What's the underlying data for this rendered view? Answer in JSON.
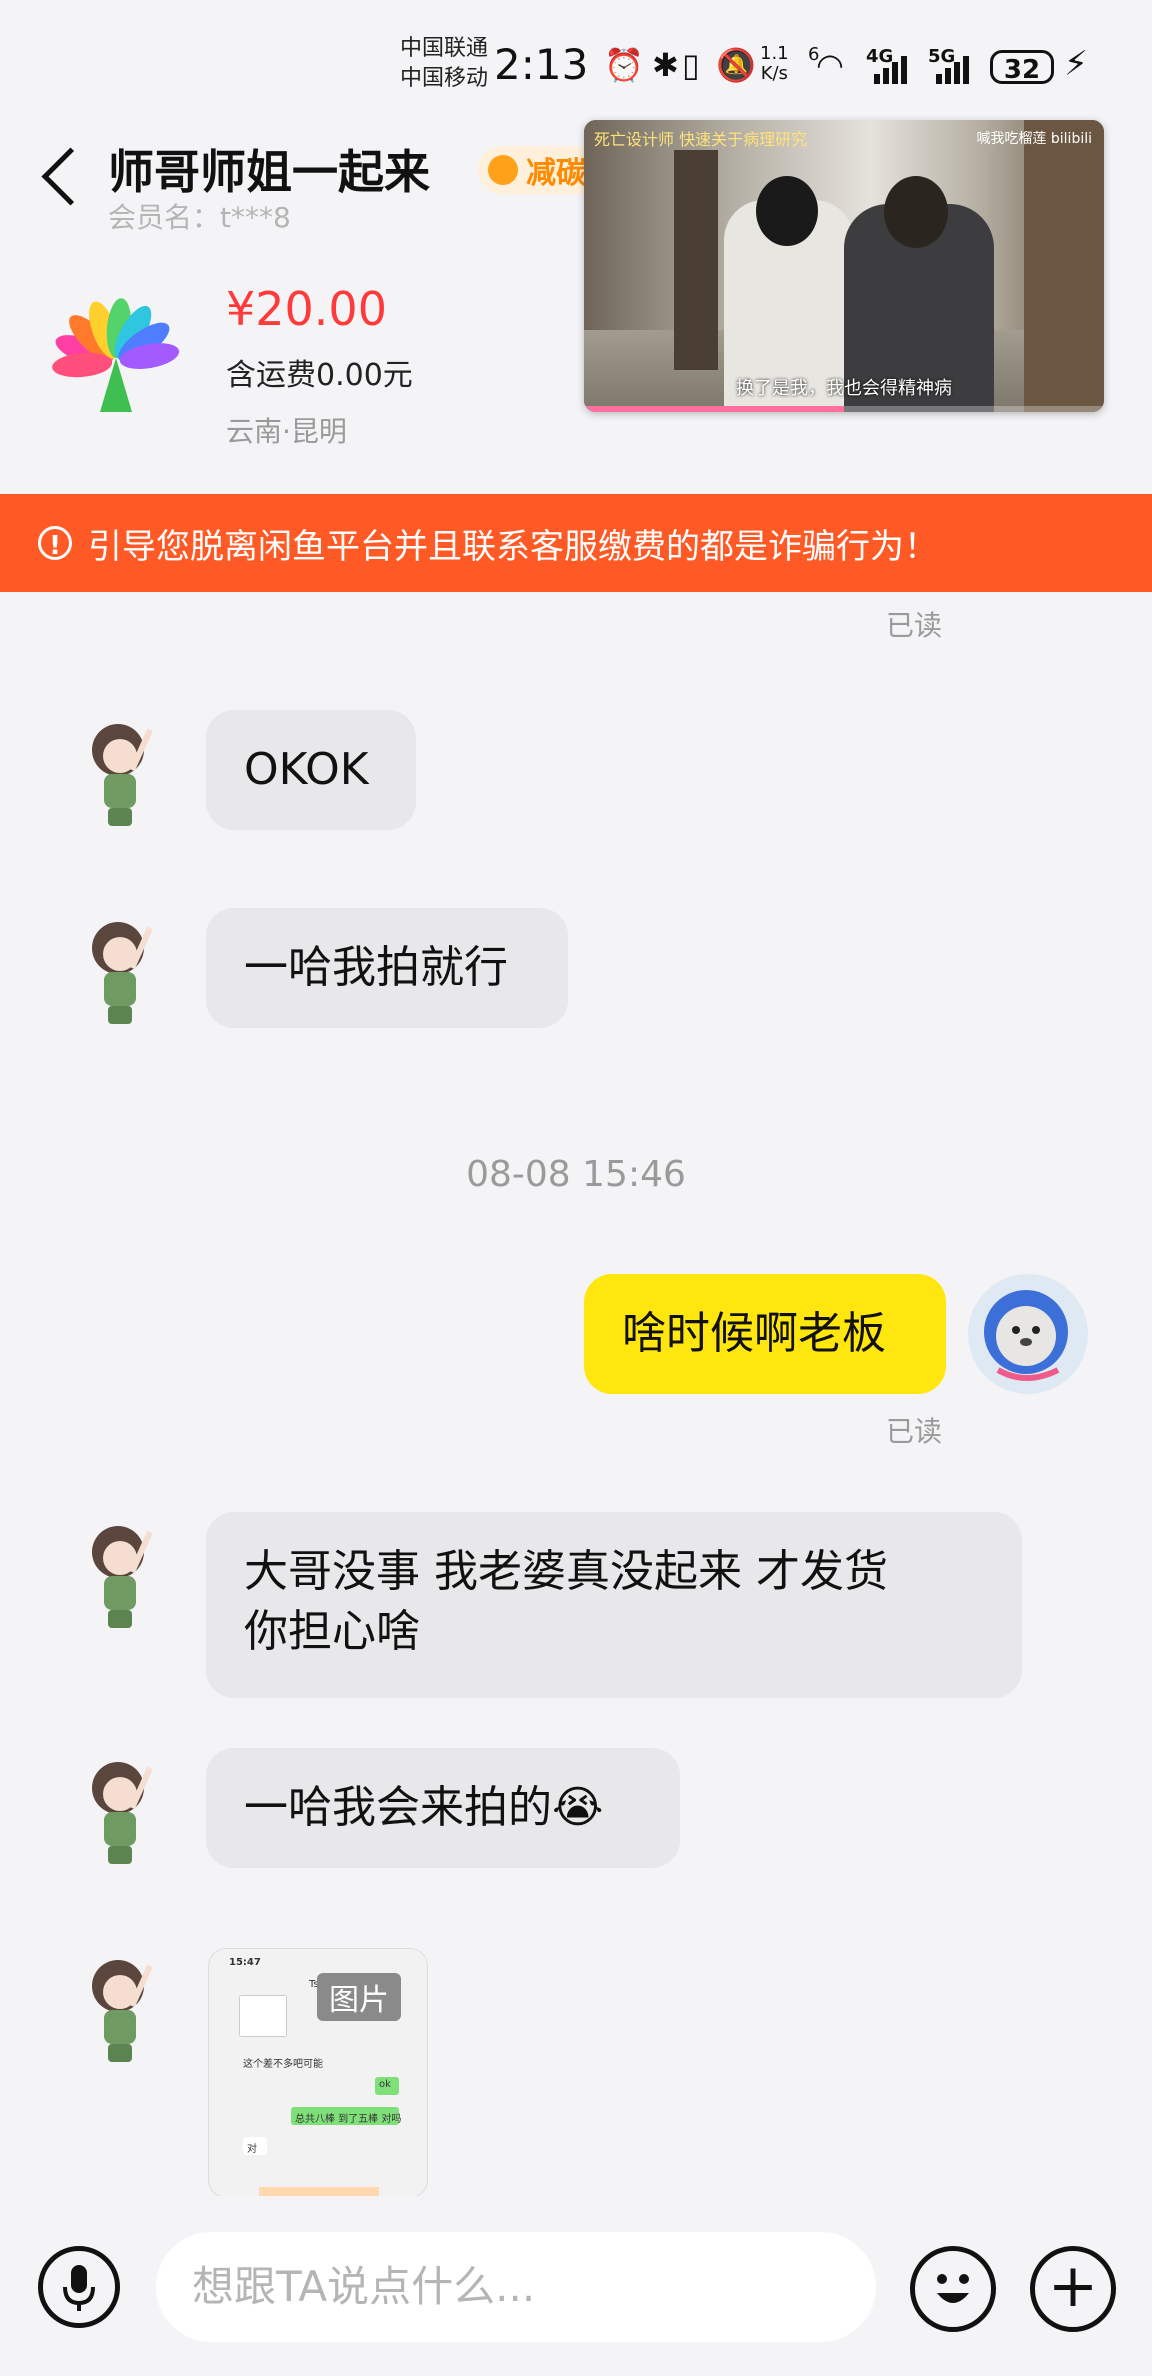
{
  "status_bar": {
    "carrier1": "中国联通",
    "carrier2": "中国移动",
    "time": "2:13",
    "speed_value": "1.1",
    "speed_unit": "K/s",
    "net_4g": "4G",
    "net_5g": "5G",
    "wifi_sup": "6",
    "battery": "32"
  },
  "header": {
    "title": "师哥师姐一起来",
    "badge": "减碳",
    "member": "会员名：t***8"
  },
  "product": {
    "price": "¥20.00",
    "shipping": "含运费0.00元",
    "location": "云南·昆明"
  },
  "pip": {
    "top_caption": "死亡设计师 快速关于病理研究",
    "brand": "喊我吃榴莲 bilibili",
    "subtitle": "换了是我，我也会得精神病",
    "progress": 0.5
  },
  "warning": {
    "text": "引导您脱离闲鱼平台并且联系客服缴费的都是诈骗行为！"
  },
  "chat": {
    "read1": "已读",
    "msg1": "OKOK",
    "msg2": "一哈我拍就行",
    "time1": "08-08 15:46",
    "my_msg": "啥时候啊老板",
    "read2": "已读",
    "msg3_line1": "大哥没事 我老婆真没起来 才发货",
    "msg3_line2": "你担心啥",
    "msg4": "一哈我会来拍的😭",
    "image_tag": "图片",
    "image_mini": {
      "time": "15:47",
      "name": "Tsuki",
      "l1": "这个差不多吧可能",
      "l2": "ok",
      "l3": "总共八棒 到了五棒 对吗",
      "l4": "对"
    }
  },
  "input": {
    "placeholder": "想跟TA说点什么..."
  },
  "colors": {
    "warning_bg": "#ff5a26",
    "my_bubble": "#ffe60f",
    "price": "#ff3a3a"
  }
}
